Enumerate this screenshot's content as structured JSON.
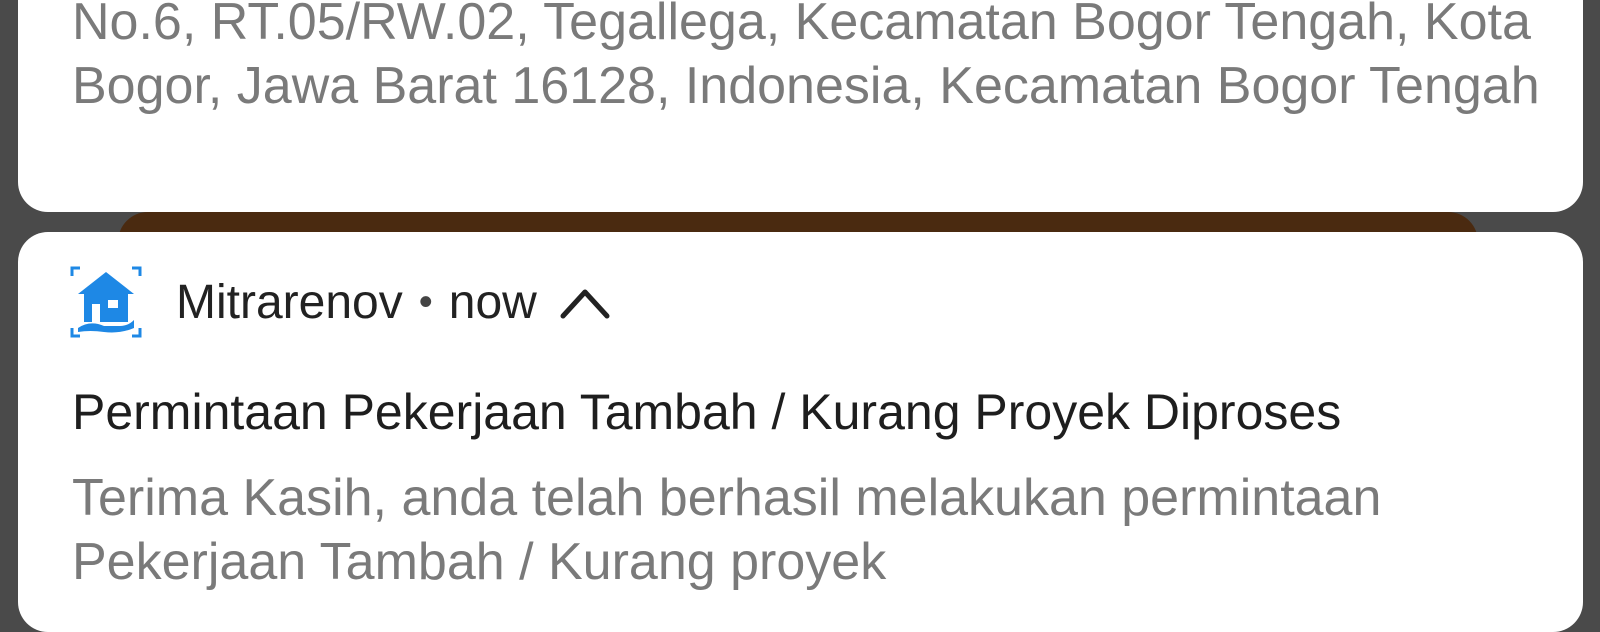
{
  "previous_notification": {
    "body_text": "No.6, RT.05/RW.02, Tegallega, Kecamatan Bogor Tengah, Kota Bogor, Jawa Barat 16128, Indonesia, Kecamatan Bogor Tengah"
  },
  "notification": {
    "app_name": "Mitrarenov",
    "separator": "•",
    "time": "now",
    "title": "Permintaan Pekerjaan Tambah / Kurang Proyek Diproses",
    "message": "Terima Kasih, anda telah berhasil melakukan permintaan Pekerjaan Tambah / Kurang proyek",
    "icon": "house-icon",
    "accent_color": "#1e88e5"
  }
}
